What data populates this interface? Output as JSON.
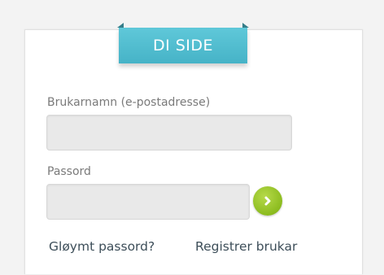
{
  "header": {
    "title": "DI SIDE"
  },
  "form": {
    "username_label": "Brukarnamn (e-postadresse)",
    "username_value": "",
    "password_label": "Passord",
    "password_value": "",
    "submit_icon": "chevron-right-icon"
  },
  "links": {
    "forgot_password": "Gløymt passord?",
    "register": "Registrer brukar"
  },
  "colors": {
    "ribbon": "#4fbdd0",
    "submit_button": "#8cbc1f",
    "link_text": "#3d4e59",
    "label_text": "#7a7a7a"
  }
}
